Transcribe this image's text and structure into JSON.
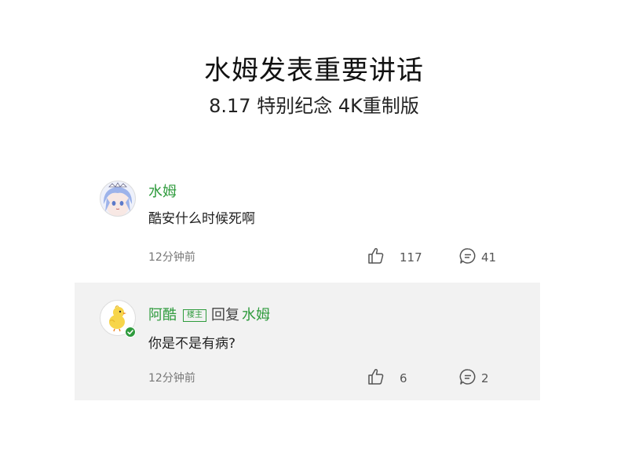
{
  "header": {
    "title": "水姆发表重要讲话",
    "subtitle": "8.17 特别纪念 4K重制版"
  },
  "comments": [
    {
      "avatar_icon": "anime-girl-avatar-icon",
      "username": "水姆",
      "content": "酷安什么时候死啊",
      "time": "12分钟前",
      "likes": "117",
      "replies": "41"
    },
    {
      "avatar_icon": "yellow-chick-avatar-icon",
      "username": "阿酷",
      "op_badge": "楼主",
      "reply_word": "回复",
      "reply_to": "水姆",
      "content": "你是不是有病?",
      "time": "12分钟前",
      "likes": "6",
      "replies": "2"
    }
  ],
  "colors": {
    "username": "#2f9b3d",
    "reply_background": "#f2f2f2",
    "verified_badge": "#2f9b3d"
  }
}
